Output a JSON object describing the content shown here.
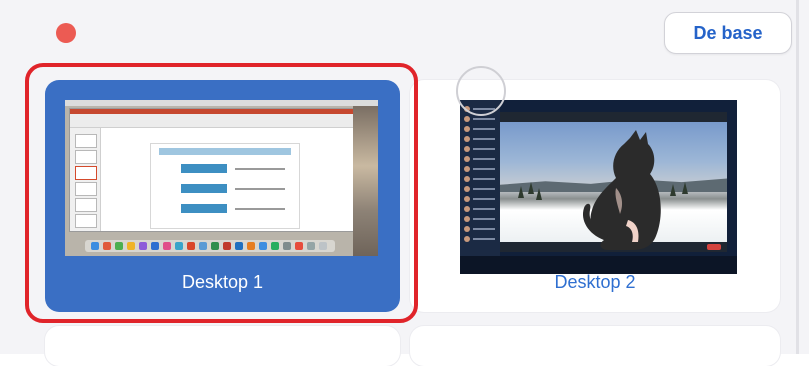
{
  "window": {
    "close_icon": "close-dot-icon",
    "tab_label": "De base"
  },
  "cards": [
    {
      "label": "Desktop 1",
      "selected": true
    },
    {
      "label": "Desktop 2",
      "selected": false
    }
  ],
  "colors": {
    "accent": "#3a6fc4",
    "link_blue": "#2f6fd0",
    "highlight_red": "#e0242a",
    "close_red": "#ec5b53"
  }
}
